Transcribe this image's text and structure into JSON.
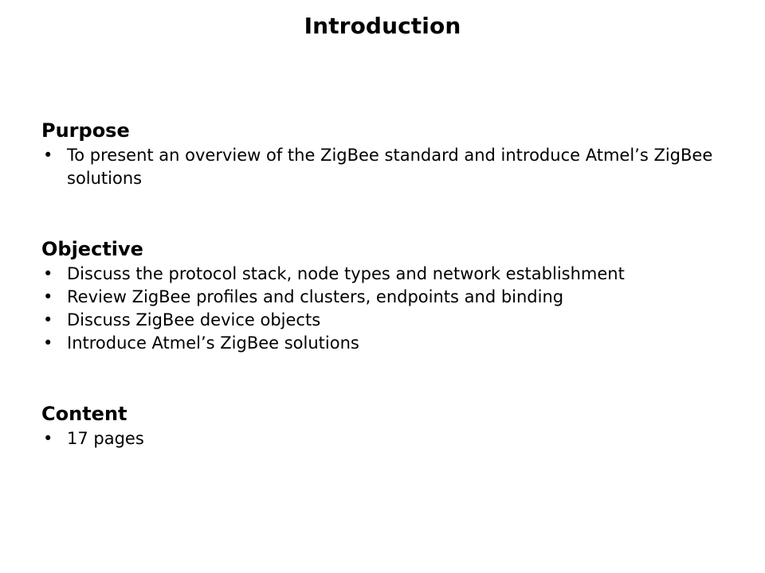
{
  "slide": {
    "title": "Introduction",
    "bullet_glyph": "•",
    "text_color": "#000000",
    "background_color": "#ffffff",
    "sections": [
      {
        "heading": "Purpose",
        "bullets": [
          "To present an overview of the ZigBee standard and introduce Atmel’s ZigBee solutions"
        ]
      },
      {
        "heading": "Objective",
        "bullets": [
          "Discuss the protocol stack, node types and network establishment",
          "Review ZigBee profiles and clusters, endpoints and binding",
          "Discuss ZigBee device objects",
          "Introduce Atmel’s ZigBee solutions"
        ]
      },
      {
        "heading": "Content",
        "bullets": [
          "17 pages"
        ]
      }
    ]
  }
}
